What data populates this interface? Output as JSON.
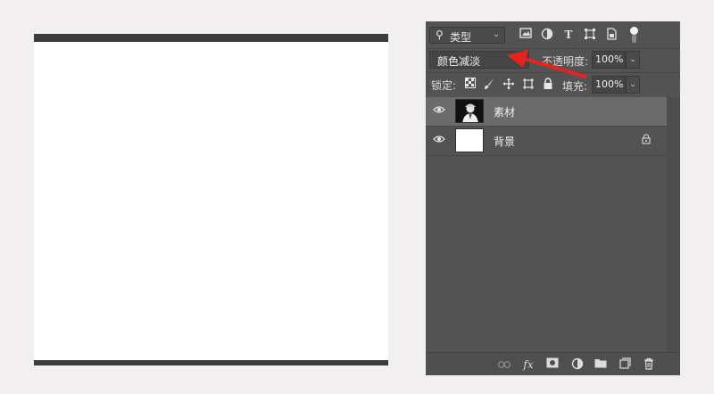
{
  "filter": {
    "label": "类型"
  },
  "blend_mode": {
    "value": "颜色减淡"
  },
  "opacity": {
    "label": "不透明度:",
    "value": "100%"
  },
  "lock": {
    "label": "锁定:"
  },
  "fill": {
    "label": "填充:",
    "value": "100%"
  },
  "layers": [
    {
      "name": "素材",
      "selected": true,
      "thumbnail": "portrait"
    },
    {
      "name": "背景",
      "selected": false,
      "thumbnail": "white",
      "locked": true
    }
  ],
  "colors": {
    "panel_bg": "#535353",
    "selected_row": "#6b6b6b",
    "annotation_arrow": "#e8231f"
  }
}
